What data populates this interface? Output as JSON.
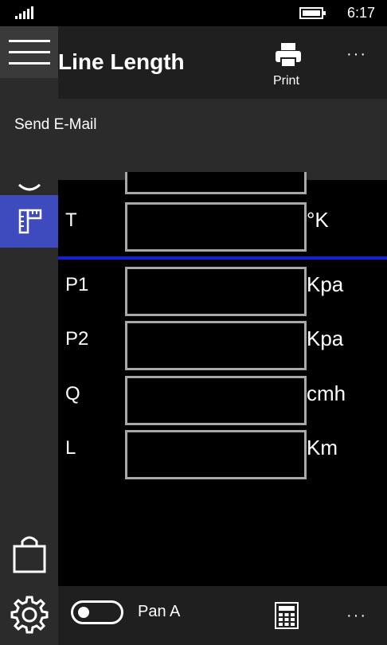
{
  "status_bar": {
    "time": "6:17"
  },
  "app_bar": {
    "title": "Line Length",
    "print_label": "Print",
    "more": "···"
  },
  "menu": {
    "items": [
      {
        "label": "Send E-Mail"
      }
    ]
  },
  "fields": [
    {
      "label": "T",
      "unit": "°K"
    },
    {
      "label": "P1",
      "unit": "Kpa"
    },
    {
      "label": "P2",
      "unit": "Kpa"
    },
    {
      "label": "Q",
      "unit": "cmh"
    },
    {
      "label": "L",
      "unit": "Km"
    }
  ],
  "bottom_bar": {
    "toggle_label": "Pan A",
    "more": "···"
  },
  "colors": {
    "accent": "#3e4bbf",
    "divider": "#1220d8",
    "rail": "#2b2b2b",
    "bar": "#1f1f1f"
  }
}
